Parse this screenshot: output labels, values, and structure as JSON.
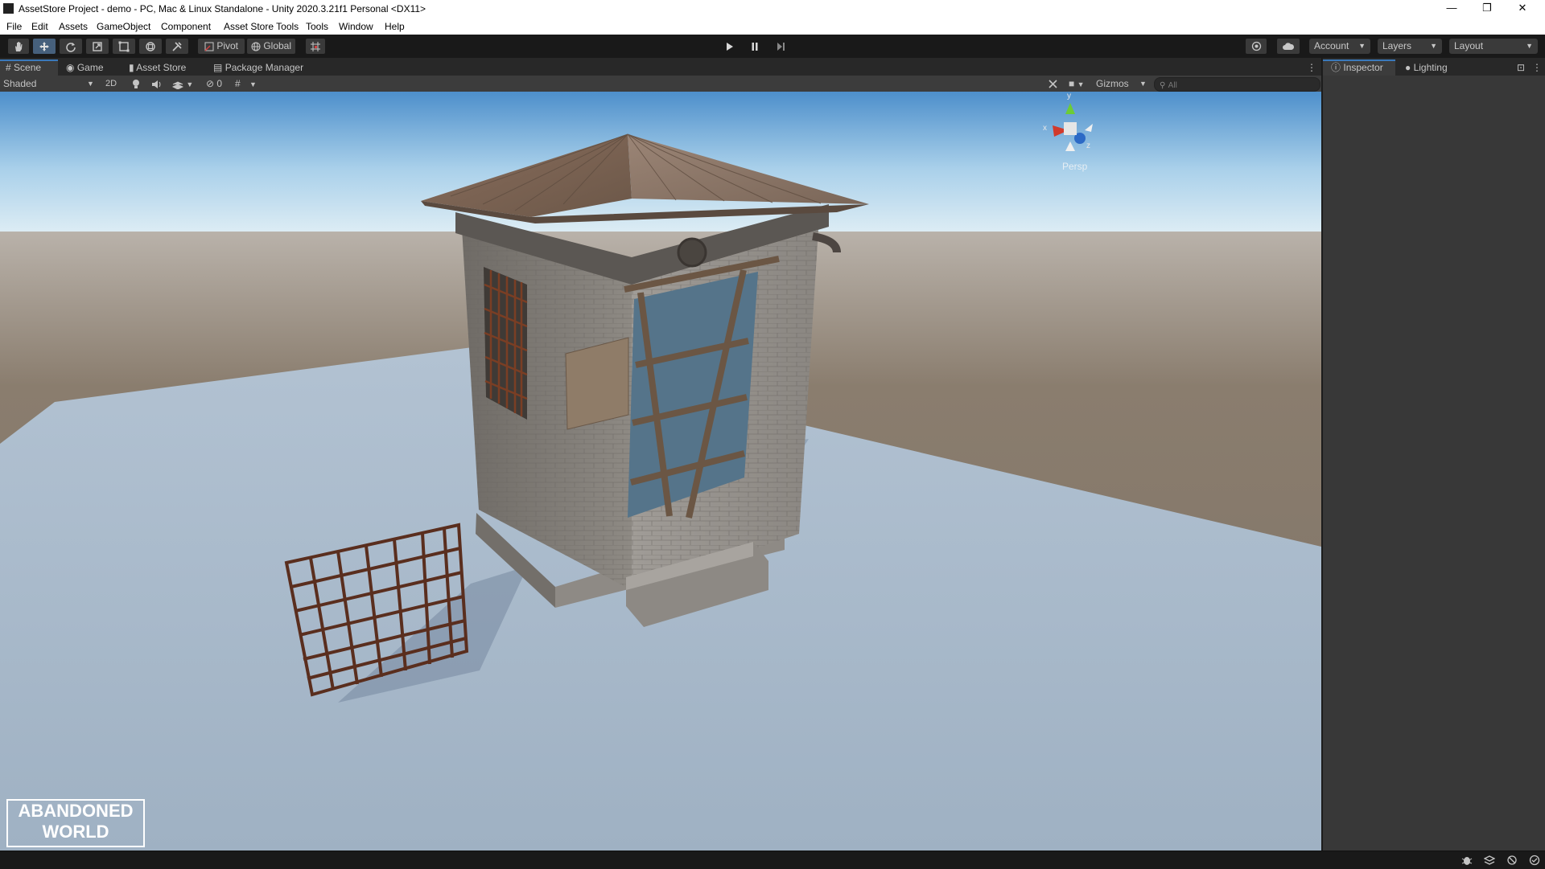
{
  "window": {
    "title": "AssetStore Project - demo - PC, Mac & Linux Standalone - Unity 2020.3.21f1 Personal <DX11>",
    "minimize": "—",
    "maximize": "❐",
    "close": "✕"
  },
  "menu": [
    "File",
    "Edit",
    "Assets",
    "GameObject",
    "Component",
    "Asset Store Tools",
    "Tools",
    "Window",
    "Help"
  ],
  "toolbar": {
    "tools": [
      "hand-tool-icon",
      "move-tool-icon",
      "rotate-tool-icon",
      "scale-tool-icon",
      "rect-tool-icon",
      "transform-tool-icon",
      "custom-tool-icon"
    ],
    "active_tool": "move-tool-icon",
    "pivot_label": "Pivot",
    "global_label": "Global",
    "account_label": "Account",
    "layers_label": "Layers",
    "layout_label": "Layout"
  },
  "scene_tabs": [
    {
      "label": "Scene",
      "icon": "grid-icon",
      "active": true
    },
    {
      "label": "Game",
      "icon": "gamepad-icon",
      "active": false
    },
    {
      "label": "Asset Store",
      "icon": "bag-icon",
      "active": false
    },
    {
      "label": "Package Manager",
      "icon": "package-icon",
      "active": false
    }
  ],
  "scene_toolbar": {
    "draw_mode": "Shaded",
    "mode_2d": "2D",
    "hidden_count": "0",
    "gizmos_label": "Gizmos",
    "search_placeholder": "All"
  },
  "viewport": {
    "projection_label": "Persp",
    "axis_y": "y",
    "axis_x": "x",
    "axis_z": "z",
    "watermark_line1": "ABANDONED",
    "watermark_line2": "WORLD"
  },
  "right_tabs": [
    {
      "label": "Inspector",
      "icon": "info-icon",
      "active": true
    },
    {
      "label": "Lighting",
      "icon": "bulb-icon",
      "active": false
    }
  ],
  "colors": {
    "accent": "#3a79bb",
    "sky_top": "#4d8fcb",
    "horizon": "#dcecf4",
    "ground": "#8a7d6e",
    "plane": "#a7b8c8"
  }
}
